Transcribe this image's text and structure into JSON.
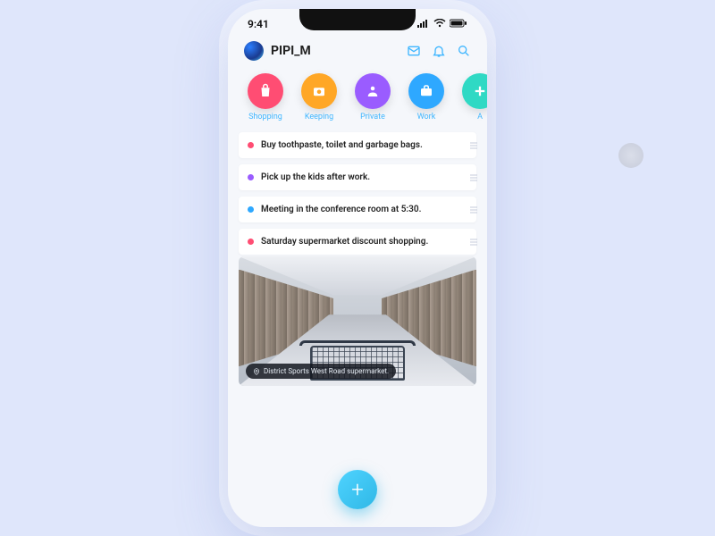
{
  "status": {
    "time": "9:41"
  },
  "header": {
    "username": "PIPI_M",
    "icons": {
      "mail": "mail-icon",
      "bell": "bell-icon",
      "search": "search-icon"
    }
  },
  "categories": [
    {
      "label": "Shopping",
      "color": "#ff4d73",
      "icon": "bag-icon"
    },
    {
      "label": "Keeping",
      "color": "#ffa726",
      "icon": "camera-icon"
    },
    {
      "label": "Private",
      "color": "#9a5cff",
      "icon": "person-icon"
    },
    {
      "label": "Work",
      "color": "#2ea8ff",
      "icon": "briefcase-icon"
    },
    {
      "label": "A",
      "color": "#2fd9c4",
      "icon": "plus-icon"
    }
  ],
  "tasks": [
    {
      "dot": "#ff4d73",
      "text": "Buy toothpaste, toilet and garbage bags."
    },
    {
      "dot": "#9a5cff",
      "text": "Pick up the kids after work."
    },
    {
      "dot": "#2ea8ff",
      "text": "Meeting in the conference room at 5:30."
    },
    {
      "dot": "#ff4d73",
      "text": "Saturday supermarket discount shopping."
    }
  ],
  "image_card": {
    "location_label": "District Sports West Road supermarket."
  },
  "fab": {
    "label": "+"
  }
}
